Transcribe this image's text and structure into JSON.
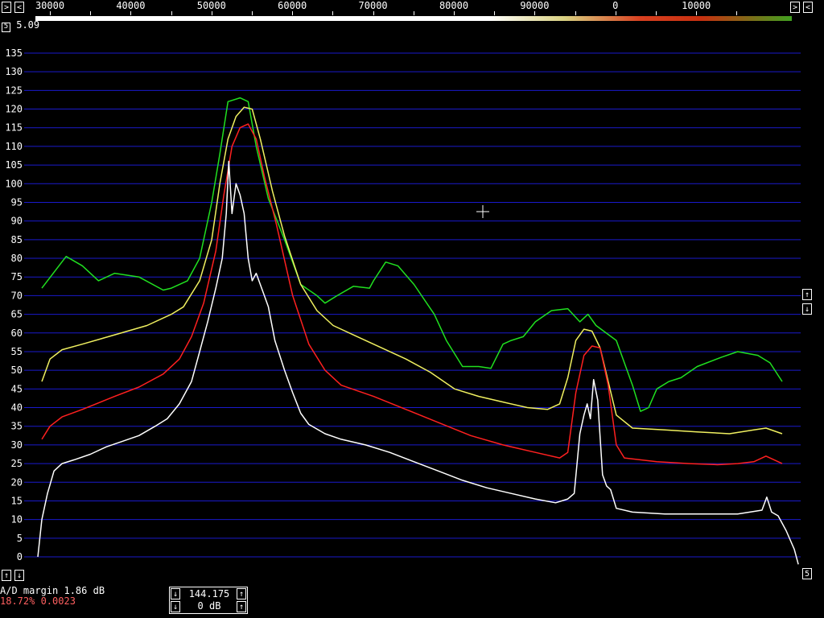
{
  "top_axis": {
    "labels": [
      "30000",
      "40000",
      "50000",
      "60000",
      "70000",
      "80000",
      "90000",
      "0",
      "10000"
    ]
  },
  "averaging": {
    "label": "5.09",
    "box": "5"
  },
  "right_controls": {
    "up": "↑",
    "down": "↓",
    "page": "5"
  },
  "left_controls": {
    "up": "↑",
    "down": "↓"
  },
  "status": {
    "ad_margin": "A/D margin  1.86 dB",
    "percent": "18.72% 0.0023"
  },
  "control_box": {
    "frequency": "144.175",
    "gain": "0 dB"
  },
  "colors": {
    "grid": "#1a1acc",
    "green": "#20e020",
    "yellow": "#f0f060",
    "red": "#ff2020",
    "white": "#ffffff"
  },
  "chart_data": {
    "type": "line",
    "x_axis": {
      "labels": [
        "30000",
        "40000",
        "50000",
        "60000",
        "70000",
        "80000",
        "90000",
        "0",
        "10000"
      ]
    },
    "yticks": [
      135,
      130,
      125,
      120,
      115,
      110,
      105,
      100,
      95,
      90,
      85,
      80,
      75,
      70,
      65,
      60,
      55,
      50,
      45,
      40,
      35,
      30,
      25,
      20,
      15,
      10,
      5,
      0
    ],
    "ylim": [
      0,
      135
    ],
    "grid": true,
    "series": [
      {
        "color": "#20e020",
        "values": [
          [
            0,
            72
          ],
          [
            3,
            80.5
          ],
          [
            5,
            78
          ],
          [
            7,
            74
          ],
          [
            9,
            76
          ],
          [
            12,
            75
          ],
          [
            15,
            71.5
          ],
          [
            16,
            72
          ],
          [
            18,
            74
          ],
          [
            19.5,
            80
          ],
          [
            21,
            95
          ],
          [
            22,
            108
          ],
          [
            23,
            122
          ],
          [
            24.5,
            123
          ],
          [
            25.5,
            122
          ],
          [
            26.5,
            110
          ],
          [
            28,
            96
          ],
          [
            30,
            85
          ],
          [
            32,
            73
          ],
          [
            34,
            70
          ],
          [
            35,
            68
          ],
          [
            36.5,
            70
          ],
          [
            38.5,
            72.5
          ],
          [
            40.5,
            72
          ],
          [
            41,
            74
          ],
          [
            42.5,
            79
          ],
          [
            44,
            78
          ],
          [
            46,
            73
          ],
          [
            48.5,
            65
          ],
          [
            50,
            58
          ],
          [
            52,
            51
          ],
          [
            54,
            51
          ],
          [
            55.5,
            50.5
          ],
          [
            57,
            57
          ],
          [
            58,
            58
          ],
          [
            59.5,
            59
          ],
          [
            61,
            63
          ],
          [
            63,
            66
          ],
          [
            65,
            66.5
          ],
          [
            66.5,
            63
          ],
          [
            67.5,
            65
          ],
          [
            68.5,
            62
          ],
          [
            71,
            58
          ],
          [
            73,
            46
          ],
          [
            74,
            39
          ],
          [
            75,
            40
          ],
          [
            76,
            45
          ],
          [
            77.5,
            47
          ],
          [
            79,
            48
          ],
          [
            81,
            51
          ],
          [
            84,
            53.5
          ],
          [
            86,
            55
          ],
          [
            88.5,
            54
          ],
          [
            90,
            52
          ],
          [
            91.5,
            47
          ]
        ]
      },
      {
        "color": "#f0f060",
        "values": [
          [
            0,
            47
          ],
          [
            1,
            53
          ],
          [
            2.5,
            55.5
          ],
          [
            5,
            57
          ],
          [
            9,
            59.5
          ],
          [
            13,
            62
          ],
          [
            16,
            65
          ],
          [
            17.5,
            67
          ],
          [
            19.5,
            74
          ],
          [
            21,
            85
          ],
          [
            22,
            100
          ],
          [
            23,
            112
          ],
          [
            24,
            118
          ],
          [
            25,
            120.5
          ],
          [
            26,
            120
          ],
          [
            27,
            112
          ],
          [
            28.5,
            98
          ],
          [
            30,
            86
          ],
          [
            32,
            73
          ],
          [
            34,
            66
          ],
          [
            36,
            62
          ],
          [
            39,
            59
          ],
          [
            42,
            56
          ],
          [
            45,
            53
          ],
          [
            48,
            49.5
          ],
          [
            51,
            45
          ],
          [
            54,
            43
          ],
          [
            57,
            41.5
          ],
          [
            60,
            40
          ],
          [
            62.5,
            39.5
          ],
          [
            64,
            41
          ],
          [
            65,
            48
          ],
          [
            66,
            58
          ],
          [
            67,
            61
          ],
          [
            68,
            60.5
          ],
          [
            69,
            56
          ],
          [
            70,
            47
          ],
          [
            71,
            38
          ],
          [
            73,
            34.5
          ],
          [
            77,
            34
          ],
          [
            81,
            33.5
          ],
          [
            85,
            33
          ],
          [
            88,
            34
          ],
          [
            89.5,
            34.5
          ],
          [
            91.5,
            33
          ]
        ]
      },
      {
        "color": "#ff2020",
        "values": [
          [
            0,
            31.5
          ],
          [
            1,
            35
          ],
          [
            2.5,
            37.5
          ],
          [
            5,
            39.5
          ],
          [
            9,
            43
          ],
          [
            12,
            45.5
          ],
          [
            15,
            49
          ],
          [
            17,
            53
          ],
          [
            18.5,
            59
          ],
          [
            20,
            68
          ],
          [
            21.5,
            82
          ],
          [
            22.5,
            97
          ],
          [
            23.5,
            110
          ],
          [
            24.5,
            115
          ],
          [
            25.5,
            116
          ],
          [
            26.5,
            112
          ],
          [
            27.5,
            102
          ],
          [
            29,
            89
          ],
          [
            31,
            70
          ],
          [
            33,
            57
          ],
          [
            35,
            50
          ],
          [
            37,
            46
          ],
          [
            41,
            43
          ],
          [
            45,
            39.5
          ],
          [
            49,
            36
          ],
          [
            53,
            32.5
          ],
          [
            57,
            30
          ],
          [
            61,
            28
          ],
          [
            64,
            26.5
          ],
          [
            65,
            28
          ],
          [
            66,
            44
          ],
          [
            67,
            54
          ],
          [
            68,
            56.5
          ],
          [
            69,
            56
          ],
          [
            70,
            46
          ],
          [
            71,
            30
          ],
          [
            72,
            26.5
          ],
          [
            76,
            25.5
          ],
          [
            80,
            25
          ],
          [
            83.5,
            24.7
          ],
          [
            86,
            25
          ],
          [
            88,
            25.5
          ],
          [
            89.5,
            27
          ],
          [
            91.5,
            25
          ]
        ]
      },
      {
        "color": "#ffffff",
        "values": [
          [
            -0.5,
            0
          ],
          [
            0,
            10
          ],
          [
            0.7,
            17
          ],
          [
            1.5,
            23
          ],
          [
            2.5,
            25
          ],
          [
            4,
            26
          ],
          [
            6,
            27.5
          ],
          [
            8,
            29.5
          ],
          [
            10,
            31
          ],
          [
            12,
            32.5
          ],
          [
            14,
            35
          ],
          [
            15.5,
            37
          ],
          [
            17,
            41
          ],
          [
            18.5,
            47
          ],
          [
            19.5,
            55
          ],
          [
            20.5,
            63
          ],
          [
            21.5,
            72
          ],
          [
            22.3,
            80
          ],
          [
            22.8,
            92
          ],
          [
            23.1,
            106
          ],
          [
            23.5,
            92
          ],
          [
            24,
            100
          ],
          [
            24.5,
            97
          ],
          [
            25,
            92
          ],
          [
            25.5,
            80
          ],
          [
            26,
            74
          ],
          [
            26.5,
            76
          ],
          [
            27.5,
            70
          ],
          [
            28,
            67
          ],
          [
            28.8,
            58
          ],
          [
            30,
            50
          ],
          [
            31,
            44
          ],
          [
            32,
            38.5
          ],
          [
            33,
            35.5
          ],
          [
            35,
            33
          ],
          [
            37,
            31.5
          ],
          [
            40,
            30
          ],
          [
            43,
            28
          ],
          [
            46,
            25.5
          ],
          [
            49,
            23
          ],
          [
            52,
            20.5
          ],
          [
            55,
            18.5
          ],
          [
            58,
            17
          ],
          [
            61,
            15.5
          ],
          [
            63.5,
            14.5
          ],
          [
            65,
            15.5
          ],
          [
            65.8,
            17
          ],
          [
            66.5,
            33
          ],
          [
            67,
            38
          ],
          [
            67.4,
            41
          ],
          [
            67.8,
            37
          ],
          [
            68.2,
            47.5
          ],
          [
            68.7,
            42
          ],
          [
            69.3,
            22
          ],
          [
            69.8,
            19
          ],
          [
            70.3,
            18
          ],
          [
            71,
            13
          ],
          [
            73,
            12
          ],
          [
            77,
            11.5
          ],
          [
            82,
            11.5
          ],
          [
            86,
            11.5
          ],
          [
            89,
            12.5
          ],
          [
            89.6,
            16
          ],
          [
            90.2,
            12
          ],
          [
            91,
            11
          ],
          [
            92,
            7
          ],
          [
            93,
            2
          ],
          [
            93.5,
            -2
          ]
        ]
      }
    ]
  }
}
